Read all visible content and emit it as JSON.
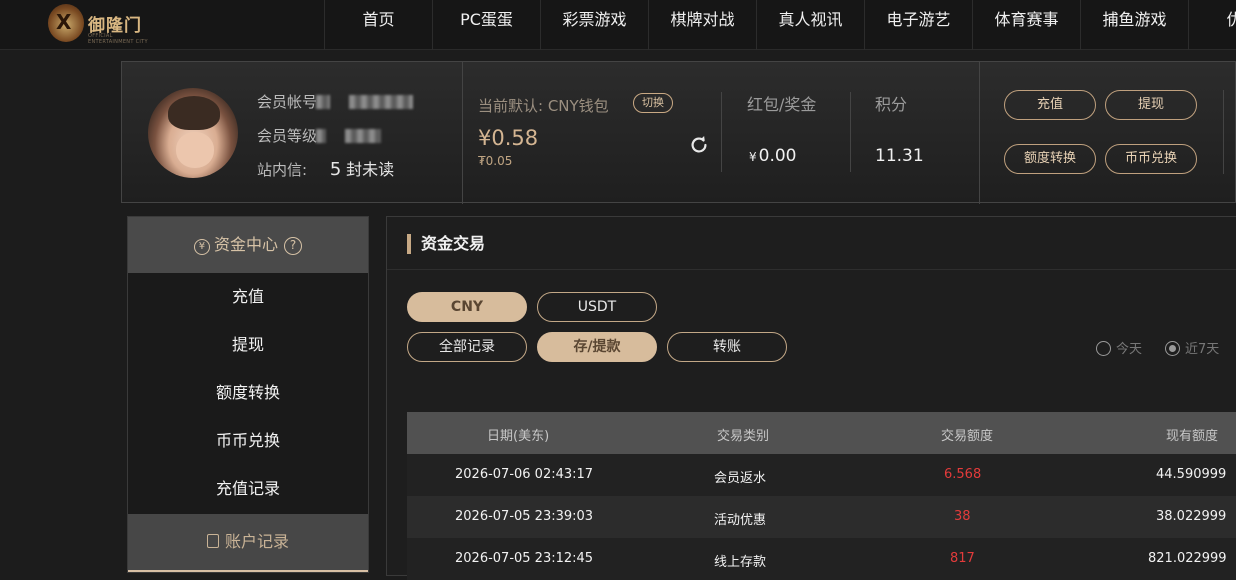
{
  "header": {
    "logo_text": "御隆门",
    "logo_sub": "OFFICIAL ENTERTAINMENT CITY",
    "nav": [
      {
        "label": "首页"
      },
      {
        "label": "PC蛋蛋"
      },
      {
        "label": "彩票游戏"
      },
      {
        "label": "棋牌对战"
      },
      {
        "label": "真人视讯"
      },
      {
        "label": "电子游艺"
      },
      {
        "label": "体育赛事"
      },
      {
        "label": "捕鱼游戏"
      },
      {
        "label": "优惠"
      }
    ]
  },
  "profile": {
    "account_label": "会员帐号",
    "level_label": "会员等级",
    "inbox_label": "站内信:",
    "inbox_count": "5",
    "inbox_unread": "封未读",
    "wallet_label": "当前默认: CNY钱包",
    "switch_label": "切换",
    "balance_main": "¥0.58",
    "balance_sub": "₮0.05",
    "bonus_label": "红包/奖金",
    "bonus_currency": "¥",
    "bonus_value": "0.00",
    "points_label": "积分",
    "points_value": "11.31",
    "buttons": {
      "deposit": "充值",
      "withdraw": "提现",
      "transfer": "额度转换",
      "exchange": "币币兑换"
    }
  },
  "sidebar": {
    "title": "资金中心",
    "title_icon": "yen-icon",
    "help_symbol": "?",
    "items": [
      {
        "label": "充值"
      },
      {
        "label": "提现"
      },
      {
        "label": "额度转换"
      },
      {
        "label": "币币兑换"
      },
      {
        "label": "充值记录"
      }
    ],
    "section2_title": "账户记录"
  },
  "main": {
    "title": "资金交易",
    "currency_tabs": [
      {
        "label": "CNY",
        "active": true
      },
      {
        "label": "USDT",
        "active": false
      }
    ],
    "type_tabs": [
      {
        "label": "全部记录",
        "active": false
      },
      {
        "label": "存/提款",
        "active": true
      },
      {
        "label": "转账",
        "active": false
      }
    ],
    "range": [
      {
        "label": "今天",
        "selected": false
      },
      {
        "label": "近7天",
        "selected": true
      }
    ],
    "table": {
      "headers": [
        "日期(美东)",
        "交易类别",
        "交易额度",
        "现有额度"
      ],
      "rows": [
        {
          "date": "2026-07-06 02:43:17",
          "type": "会员返水",
          "amount": "6.568",
          "balance": "44.590999"
        },
        {
          "date": "2026-07-05 23:39:03",
          "type": "活动优惠",
          "amount": "38",
          "balance": "38.022999"
        },
        {
          "date": "2026-07-05 23:12:45",
          "type": "线上存款",
          "amount": "817",
          "balance": "821.022999"
        }
      ]
    }
  },
  "colors": {
    "accent": "#d7bc9c",
    "amount_red": "#e33b3b",
    "background": "#1c1c1c"
  }
}
